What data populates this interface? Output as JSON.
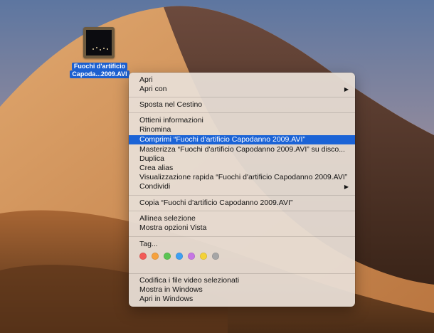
{
  "desktop": {
    "file": {
      "label_line1": "Fuochi d'artificio",
      "label_line2": "Capoda...2009.AVI",
      "icon": "video-thumbnail-icon"
    }
  },
  "context_menu": {
    "items": [
      {
        "label": "Apri"
      },
      {
        "label": "Apri con",
        "submenu": true
      },
      {
        "label": "Sposta nel Cestino"
      },
      {
        "label": "Ottieni informazioni"
      },
      {
        "label": "Rinomina"
      },
      {
        "label": "Comprimi “Fuochi d'artificio Capodanno 2009.AVI”",
        "highlighted": true
      },
      {
        "label": "Masterizza “Fuochi d'artificio Capodanno 2009.AVI” su disco..."
      },
      {
        "label": "Duplica"
      },
      {
        "label": "Crea alias"
      },
      {
        "label": "Visualizzazione rapida “Fuochi d'artificio Capodanno 2009.AVI”"
      },
      {
        "label": "Condividi",
        "submenu": true
      },
      {
        "label": "Copia “Fuochi d'artificio Capodanno 2009.AVI”"
      },
      {
        "label": "Allinea selezione"
      },
      {
        "label": "Mostra opzioni Vista"
      },
      {
        "label": "Tag..."
      },
      {
        "label": "Codifica i file video selezionati"
      },
      {
        "label": "Mostra in Windows"
      },
      {
        "label": "Apri in Windows"
      }
    ],
    "submenu_arrow": "▶",
    "tag_colors": [
      {
        "name": "red",
        "color": "#f25a57"
      },
      {
        "name": "orange",
        "color": "#f6a13c"
      },
      {
        "name": "green",
        "color": "#5bc453"
      },
      {
        "name": "blue",
        "color": "#3ea0f2"
      },
      {
        "name": "purple",
        "color": "#c676e3"
      },
      {
        "name": "yellow",
        "color": "#f4d238"
      },
      {
        "name": "gray",
        "color": "#a6a6a6"
      }
    ],
    "highlight_color": "#1b63d6"
  }
}
